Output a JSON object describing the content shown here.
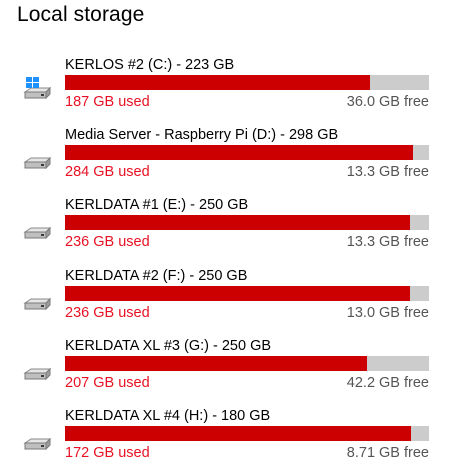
{
  "header": {
    "title": "Local storage"
  },
  "colors": {
    "used_bar": "#cc0000",
    "free_bar": "#cccccc",
    "used_text": "#e81123",
    "free_text": "#555555"
  },
  "drives": [
    {
      "icon": "windows-drive-icon",
      "name": "KERLOS #2 (C:) - 223 GB",
      "used": "187 GB used",
      "free": "36.0 GB free",
      "used_fraction": 0.8386
    },
    {
      "icon": "hard-drive-icon",
      "name": "Media Server - Raspberry Pi (D:) - 298 GB",
      "used": "284 GB used",
      "free": "13.3 GB free",
      "used_fraction": 0.9553
    },
    {
      "icon": "hard-drive-icon",
      "name": "KERLDATA #1 (E:) - 250 GB",
      "used": "236 GB used",
      "free": "13.3 GB free",
      "used_fraction": 0.9468
    },
    {
      "icon": "hard-drive-icon",
      "name": "KERLDATA #2 (F:) - 250 GB",
      "used": "236 GB used",
      "free": "13.0 GB free",
      "used_fraction": 0.948
    },
    {
      "icon": "hard-drive-icon",
      "name": "KERLDATA XL #3 (G:) - 250 GB",
      "used": "207 GB used",
      "free": "42.2 GB free",
      "used_fraction": 0.8307
    },
    {
      "icon": "hard-drive-icon",
      "name": "KERLDATA XL #4 (H:) - 180 GB",
      "used": "172 GB used",
      "free": "8.71 GB free",
      "used_fraction": 0.9518
    }
  ]
}
